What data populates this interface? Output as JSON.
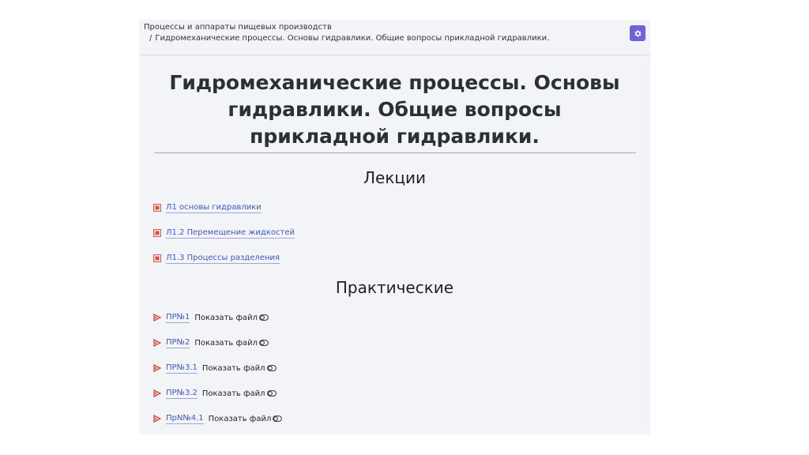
{
  "breadcrumb": {
    "course": "Процессы и аппараты пищевых производств",
    "separator": "/",
    "current": "Гидромеханические процессы. Основы гидравлики. Общие вопросы прикладной гидравлики."
  },
  "header": {
    "settings_icon": "gear-icon"
  },
  "page": {
    "title": "Гидромеханические процессы. Основы гидравлики. Общие вопросы прикладной гидравлики."
  },
  "lectures": {
    "heading": "Лекции",
    "icon": "document-icon",
    "items": [
      {
        "label": "Л1 основы гидравлики"
      },
      {
        "label": "Л1.2 Перемещение жидкостей"
      },
      {
        "label": "Л1.3 Процессы разделения"
      }
    ]
  },
  "practicals": {
    "heading": "Практические",
    "icon": "pdf-icon",
    "show_file_label": "Показать файл",
    "toggle_icon": "toggle-icon",
    "items": [
      {
        "label": "ПР№1"
      },
      {
        "label": "ПР№2"
      },
      {
        "label": "ПР№3.1"
      },
      {
        "label": "ПР№3.2"
      },
      {
        "label": "ПрN№4.1"
      }
    ]
  },
  "colors": {
    "accent": "#6f63d8",
    "link": "#3e58c9",
    "panel_background": "#f3f4f8",
    "document_icon": "#d9534f",
    "pdf_icon": "#c0392b"
  }
}
